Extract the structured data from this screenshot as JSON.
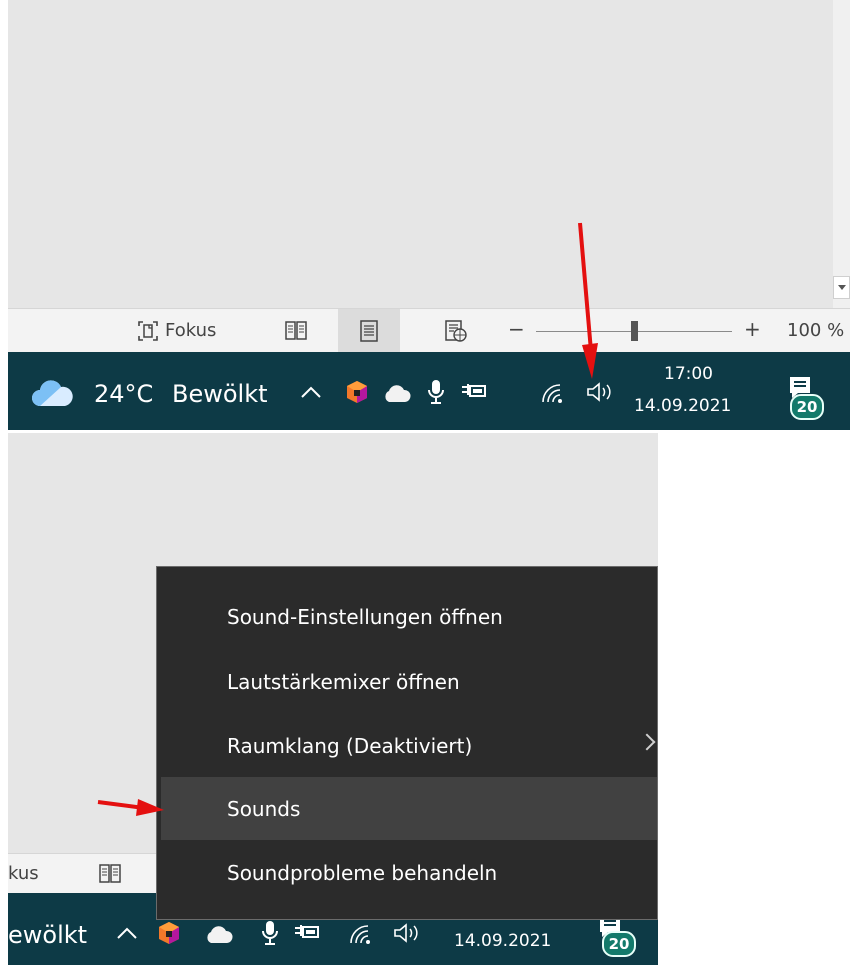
{
  "top": {
    "statusbar": {
      "focus_label": "Fokus",
      "zoom_minus": "−",
      "zoom_plus": "+",
      "zoom_level": "100 %",
      "zoom_fraction": 0.5
    },
    "taskbar": {
      "weather_temp": "24°C",
      "weather_text": "Bewölkt",
      "time": "17:00",
      "date": "14.09.2021",
      "notification_count": "20"
    }
  },
  "bottom": {
    "statusbar": {
      "focus_label_partial": "kus"
    },
    "taskbar": {
      "weather_text_partial": "ewölkt",
      "date": "14.09.2021",
      "notification_count": "20"
    },
    "context_menu": {
      "items": [
        {
          "label": "Sound-Einstellungen öffnen"
        },
        {
          "label": "Lautstärkemixer öffnen"
        },
        {
          "label": "Raumklang (Deaktiviert)"
        },
        {
          "label": "Sounds"
        },
        {
          "label": "Soundprobleme behandeln"
        }
      ]
    }
  },
  "colors": {
    "taskbar_bg": "#0d3a46",
    "menu_bg": "#2b2b2b",
    "menu_highlight": "#414141",
    "annotation_arrow": "#e41010",
    "badge_bg": "#137a6b"
  },
  "icons": [
    "cloud-icon",
    "chevron-up-icon",
    "app-cube-icon",
    "onedrive-icon",
    "microphone-icon",
    "power-plug-icon",
    "wifi-icon",
    "speaker-icon",
    "notification-icon",
    "focus-icon",
    "read-mode-icon",
    "print-layout-icon",
    "web-layout-icon",
    "scroll-down-arrow-icon"
  ]
}
